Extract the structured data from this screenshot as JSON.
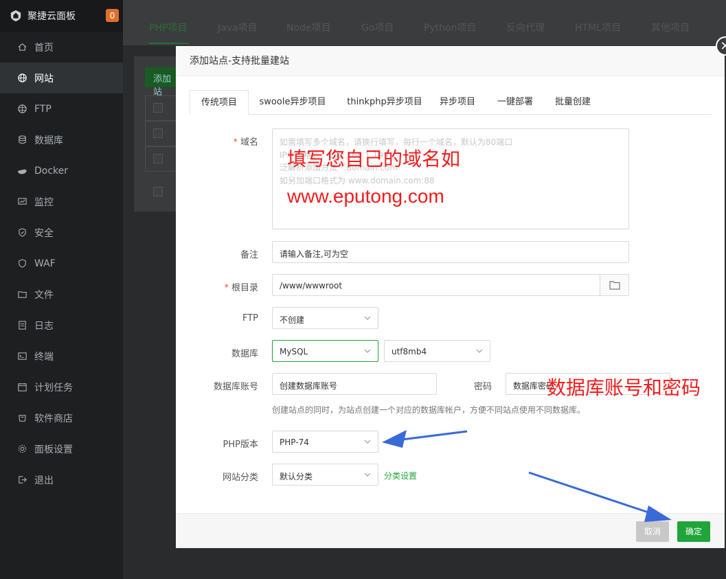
{
  "sidebar": {
    "title": "聚捷云面板",
    "badge": "0",
    "items": [
      {
        "label": "首页",
        "icon": "home-icon"
      },
      {
        "label": "网站",
        "icon": "globe-icon",
        "active": true
      },
      {
        "label": "FTP",
        "icon": "ftp-icon"
      },
      {
        "label": "数据库",
        "icon": "database-icon"
      },
      {
        "label": "Docker",
        "icon": "docker-icon"
      },
      {
        "label": "监控",
        "icon": "monitor-icon"
      },
      {
        "label": "安全",
        "icon": "shield-icon"
      },
      {
        "label": "WAF",
        "icon": "waf-icon"
      },
      {
        "label": "文件",
        "icon": "folder-icon"
      },
      {
        "label": "日志",
        "icon": "log-icon"
      },
      {
        "label": "终端",
        "icon": "terminal-icon"
      },
      {
        "label": "计划任务",
        "icon": "clock-icon"
      },
      {
        "label": "软件商店",
        "icon": "store-icon"
      },
      {
        "label": "面板设置",
        "icon": "gear-icon"
      },
      {
        "label": "退出",
        "icon": "logout-icon"
      }
    ]
  },
  "top_tabs": [
    "PHP项目",
    "Java项目",
    "Node项目",
    "Go项目",
    "Python项目",
    "反向代理",
    "HTML项目",
    "其他项目"
  ],
  "background": {
    "add_label": "添加站"
  },
  "modal": {
    "title": "添加站点-支持批量建站",
    "tabs": [
      "传统项目",
      "swoole异步项目",
      "thinkphp异步项目",
      "异步项目",
      "一键部署",
      "批量创建"
    ],
    "domain": {
      "label": "域名",
      "placeholder_lines": [
        "如需填写多个域名，请换行填写，每行一个域名，默认为80端口",
        "IP地址格式：192.168.1.199",
        "泛解析添加方法 *.domain.com",
        "如另加端口格式为 www.domain.com:88"
      ]
    },
    "remark": {
      "label": "备注",
      "placeholder": "请输入备注,可为空"
    },
    "root": {
      "label": "根目录",
      "value": "/www/wwwroot"
    },
    "ftp": {
      "label": "FTP",
      "value": "不创建"
    },
    "database": {
      "label": "数据库",
      "type": "MySQL",
      "charset": "utf8mb4"
    },
    "db_account": {
      "label": "数据库账号",
      "placeholder": "创建数据库账号"
    },
    "password": {
      "label": "密码",
      "placeholder": "数据库密码"
    },
    "help": "创建站点的同时，为站点创建一个对应的数据库帐户，方便不同站点使用不同数据库。",
    "php": {
      "label": "PHP版本",
      "value": "PHP-74"
    },
    "category": {
      "label": "网站分类",
      "value": "默认分类",
      "link": "分类设置"
    },
    "cancel_label": "取消",
    "ok_label": "确定"
  },
  "annotations": {
    "domain_hint_1": "填写您自己的域名如",
    "domain_hint_2": "www.eputong.com",
    "db_hint": "数据库账号和密码"
  },
  "colors": {
    "accent": "#20a53a",
    "annotation": "#f21c1c",
    "arrow": "#3a6ad8"
  }
}
